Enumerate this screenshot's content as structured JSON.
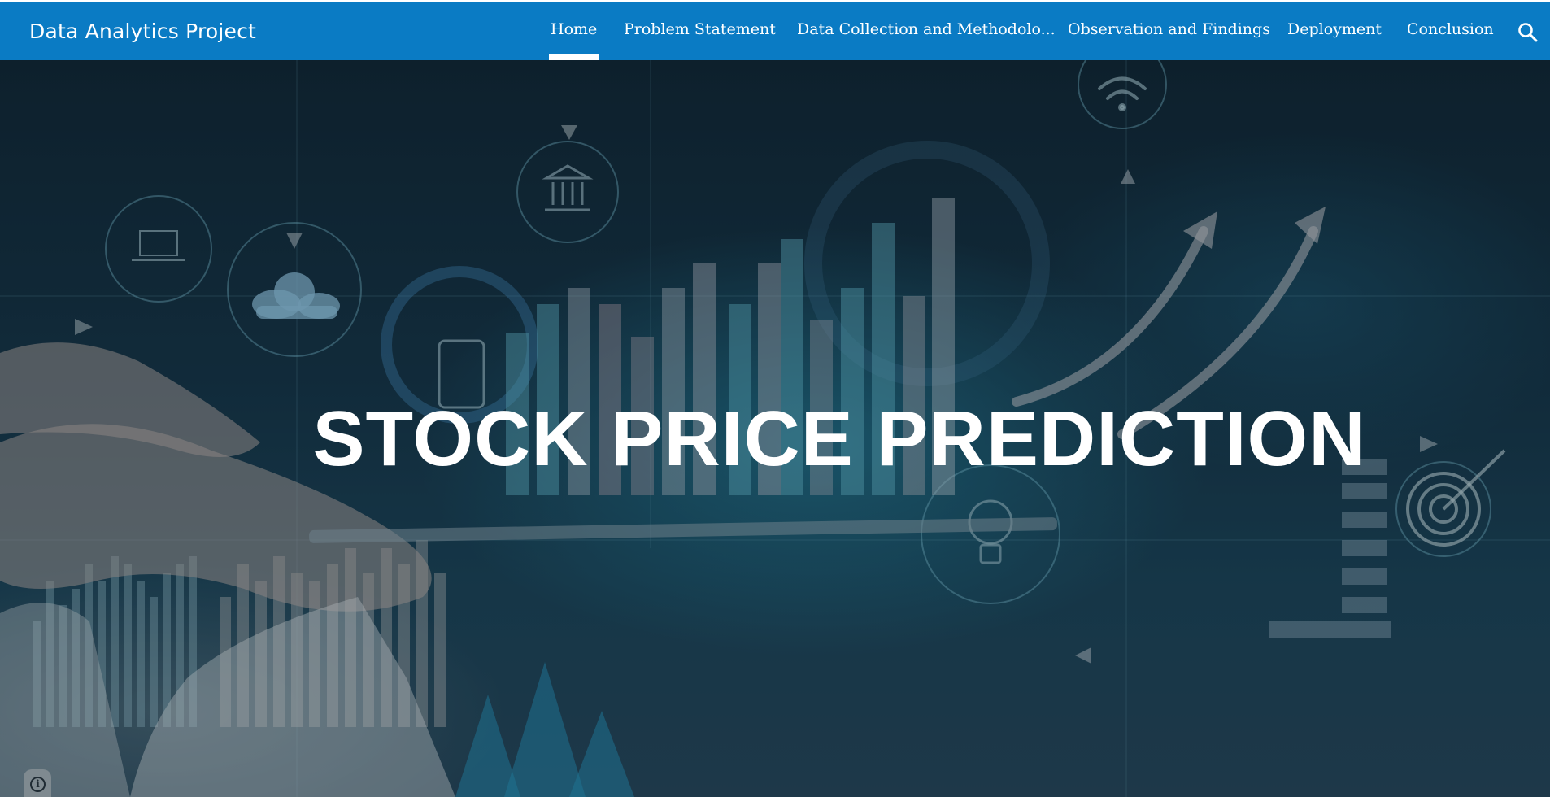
{
  "site": {
    "title": "Data Analytics Project"
  },
  "nav": {
    "items": [
      {
        "label": "Home",
        "active": true
      },
      {
        "label": "Problem Statement",
        "active": false
      },
      {
        "label": "Data Collection and Methodolo...",
        "active": false
      },
      {
        "label": "Observation and Findings",
        "active": false
      },
      {
        "label": "Deployment",
        "active": false
      },
      {
        "label": "Conclusion",
        "active": false
      }
    ],
    "search_icon": "search-icon"
  },
  "hero": {
    "title": "STOCK PRICE PREDICTION",
    "background": "stock-market-technology-image"
  },
  "info_button": {
    "icon": "info-icon",
    "glyph": "i"
  },
  "colors": {
    "nav_background": "#0a7bc4",
    "text": "#ffffff"
  }
}
